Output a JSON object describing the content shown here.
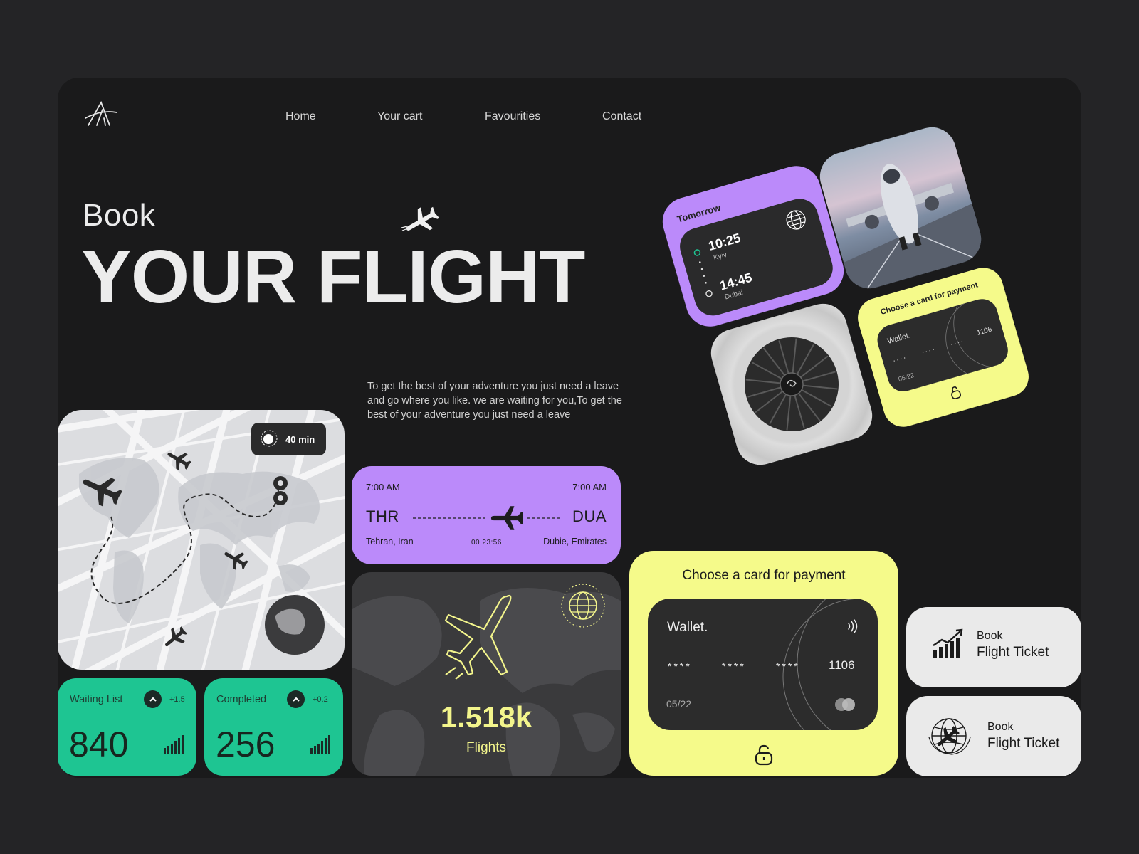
{
  "nav": {
    "items": [
      "Home",
      "Your cart",
      "Favourities",
      "Contact"
    ]
  },
  "hero": {
    "line1": "Book",
    "line2": "YOUR FLIGHT",
    "description": "To get the best of your adventure you just need a leave and go where you like. we are waiting for you,To get the best of your adventure you just need a leave"
  },
  "map": {
    "eta": "40 min"
  },
  "stats": {
    "waiting": {
      "label": "Waiting List",
      "delta": "+1.5",
      "value": "840"
    },
    "completed": {
      "label": "Completed",
      "delta": "+0.2",
      "value": "256"
    }
  },
  "route": {
    "depart_time": "7:00 AM",
    "arrive_time": "7:00 AM",
    "from_code": "THR",
    "to_code": "DUA",
    "from_city": "Tehran, Iran",
    "to_city": "Dubie, Emirates",
    "duration": "00:23:56"
  },
  "flights": {
    "value": "1.518k",
    "label": "Flights"
  },
  "payment": {
    "title": "Choose a card for payment",
    "card_name": "Wallet.",
    "masked": "****",
    "last4": "1106",
    "expiry": "05/22"
  },
  "book_buttons": [
    {
      "line1": "Book",
      "line2": "Flight Ticket",
      "icon": "chart-growth-icon"
    },
    {
      "line1": "Book",
      "line2": "Flight Ticket",
      "icon": "globe-plane-icon"
    }
  ],
  "tomorrow": {
    "label": "Tomorrow",
    "depart_time": "10:25",
    "depart_city": "Kyiv",
    "arrive_time": "14:45",
    "arrive_city": "Dubai"
  },
  "payment_small": {
    "title": "Choose a card for payment",
    "card_name": "Wallet.",
    "masked": "....",
    "last4": "1106",
    "expiry": "05/22"
  },
  "colors": {
    "purple": "#bb8afa",
    "yellow": "#f5fa8a",
    "green": "#1ec592",
    "dark": "#1a1a1b"
  }
}
